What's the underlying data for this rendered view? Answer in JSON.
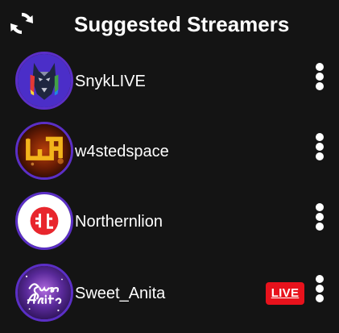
{
  "header": {
    "title": "Suggested Streamers",
    "refresh_icon": "refresh-icon"
  },
  "colors": {
    "background": "#141414",
    "avatar_ring": "#5b2fc6",
    "live_badge": "#e8121c",
    "text": "#ffffff"
  },
  "streamers": [
    {
      "name": "SnykLIVE",
      "live": false,
      "avatar_icon": "doberman-avatar",
      "menu_icon": "kebab-menu-icon"
    },
    {
      "name": "w4stedspace",
      "live": false,
      "avatar_icon": "w4-logo-avatar",
      "menu_icon": "kebab-menu-icon"
    },
    {
      "name": "Northernlion",
      "live": false,
      "avatar_icon": "northernlion-logo-avatar",
      "menu_icon": "kebab-menu-icon"
    },
    {
      "name": "Sweet_Anita",
      "live": true,
      "live_label": "LIVE",
      "avatar_icon": "sweet-anita-avatar",
      "menu_icon": "kebab-menu-icon"
    }
  ]
}
